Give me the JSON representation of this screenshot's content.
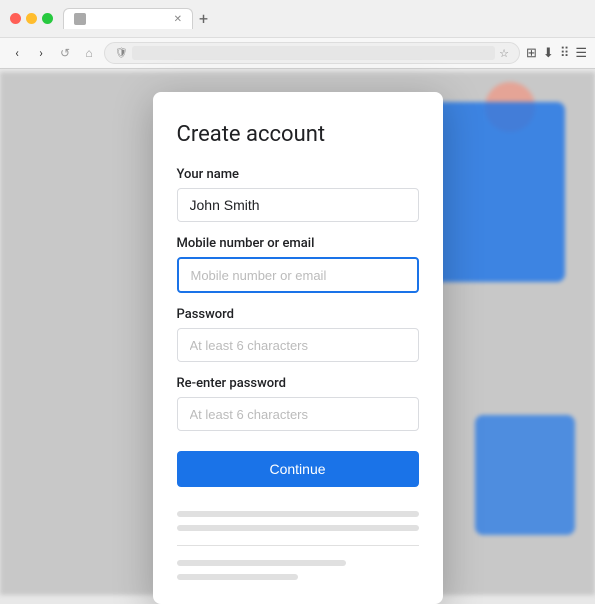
{
  "browser": {
    "tab_label": "",
    "new_tab_icon": "+",
    "back_icon": "‹",
    "forward_icon": "›",
    "refresh_icon": "↺",
    "home_icon": "⌂"
  },
  "modal": {
    "title": "Create account",
    "fields": {
      "name_label": "Your name",
      "name_value": "John Smith",
      "name_placeholder": "Your name",
      "email_label": "Mobile number or email",
      "email_value": "",
      "email_placeholder": "Mobile number or email",
      "password_label": "Password",
      "password_value": "",
      "password_placeholder": "At least 6 characters",
      "repassword_label": "Re-enter password",
      "repassword_value": "",
      "repassword_placeholder": "At least 6 characters"
    },
    "continue_button": "Continue"
  }
}
